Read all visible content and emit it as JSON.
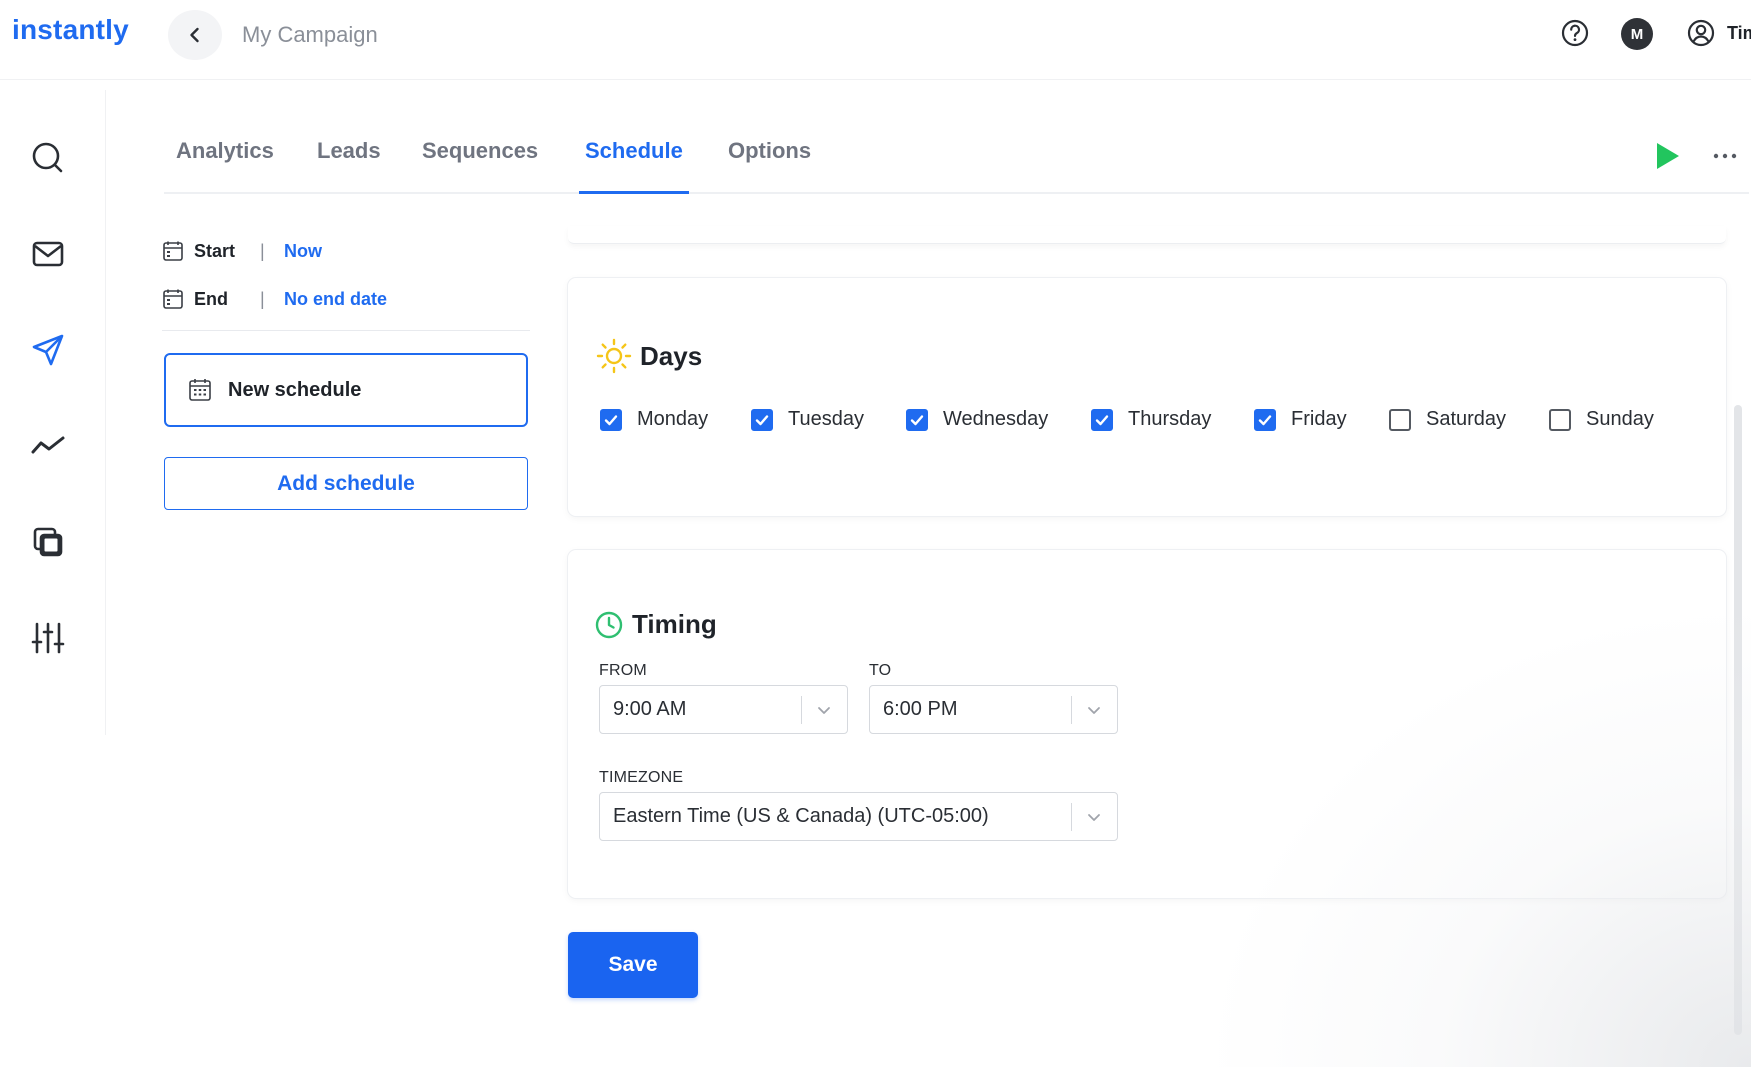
{
  "app": {
    "logo": "instantly",
    "campaign_name": "My Campaign",
    "avatar_initial": "M",
    "user_name": "Tim"
  },
  "icons": {
    "back": "chevron-left-icon",
    "help": "help-circle-icon",
    "user": "user-circle-icon",
    "rail": [
      "search-icon",
      "mail-icon",
      "send-icon",
      "analytics-icon",
      "copy-icon",
      "sliders-icon"
    ],
    "play": "play-icon",
    "more": "more-horizontal-icon"
  },
  "tabs": [
    {
      "label": "Analytics",
      "active": false
    },
    {
      "label": "Leads",
      "active": false
    },
    {
      "label": "Sequences",
      "active": false
    },
    {
      "label": "Schedule",
      "active": true
    },
    {
      "label": "Options",
      "active": false
    }
  ],
  "schedule_panel": {
    "start_label": "Start",
    "start_value": "Now",
    "end_label": "End",
    "end_value": "No end date",
    "separator": "|",
    "current_schedule": "New schedule",
    "add_button": "Add schedule"
  },
  "days": {
    "title": "Days",
    "items": [
      {
        "label": "Monday",
        "checked": true
      },
      {
        "label": "Tuesday",
        "checked": true
      },
      {
        "label": "Wednesday",
        "checked": true
      },
      {
        "label": "Thursday",
        "checked": true
      },
      {
        "label": "Friday",
        "checked": true
      },
      {
        "label": "Saturday",
        "checked": false
      },
      {
        "label": "Sunday",
        "checked": false
      }
    ]
  },
  "timing": {
    "title": "Timing",
    "from_label": "FROM",
    "from_value": "9:00 AM",
    "to_label": "TO",
    "to_value": "6:00 PM",
    "timezone_label": "TIMEZONE",
    "timezone_value": "Eastern Time (US & Canada) (UTC-05:00)"
  },
  "save_label": "Save",
  "colors": {
    "accent": "#1f6bf0",
    "play": "#22c55e",
    "sun": "#f5c518",
    "clock": "#2fbf71"
  }
}
